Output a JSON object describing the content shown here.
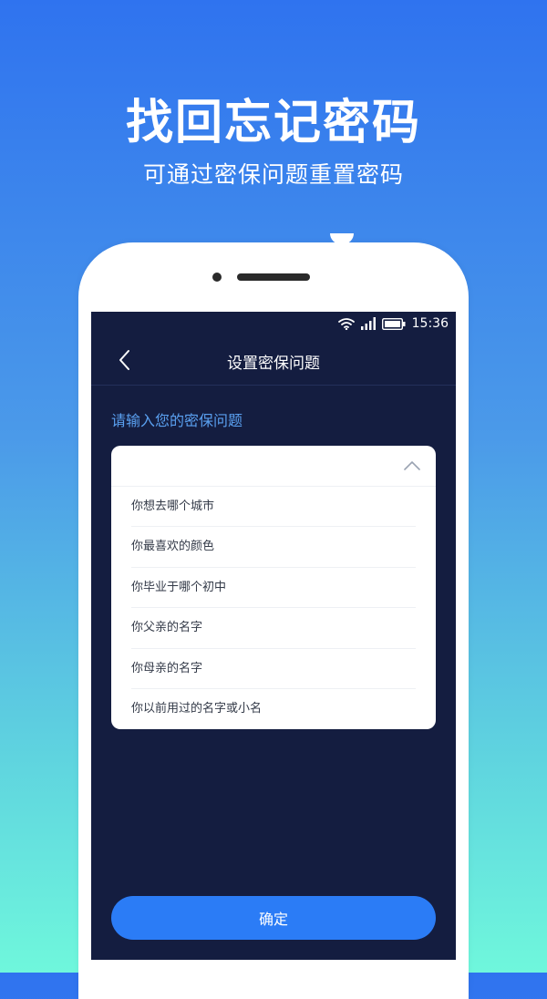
{
  "hero": {
    "title": "找回忘记密码",
    "subtitle": "可通过密保问题重置密码"
  },
  "status_bar": {
    "time": "15:36",
    "icons": [
      "wifi-icon",
      "signal-icon",
      "battery-icon"
    ]
  },
  "nav": {
    "title": "设置密保问题",
    "back_icon": "chevron-left-icon"
  },
  "form": {
    "prompt": "请输入您的密保问题",
    "dropdown_icon": "chevron-up-icon",
    "options": [
      "你想去哪个城市",
      "你最喜欢的颜色",
      "你毕业于哪个初中",
      "你父亲的名字",
      "你母亲的名字",
      "你以前用过的名字或小名"
    ]
  },
  "actions": {
    "confirm_label": "确定"
  },
  "colors": {
    "screen_background": "#141d40",
    "accent": "#2b7cf6",
    "prompt_text": "#5aa0f0"
  }
}
